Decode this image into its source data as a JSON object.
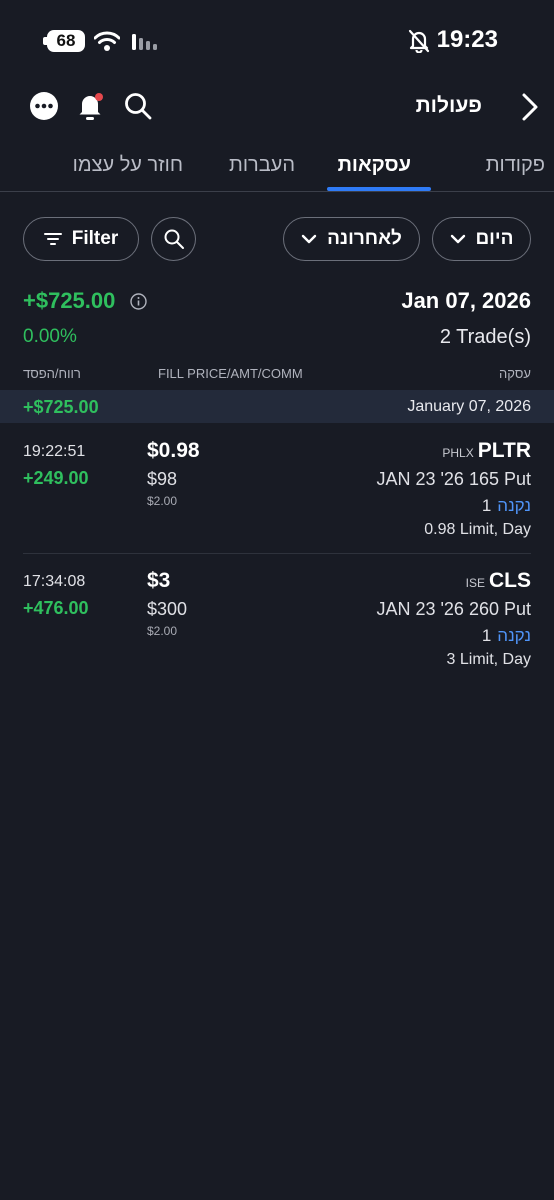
{
  "status_bar": {
    "battery": "68",
    "time": "19:23"
  },
  "header": {
    "title": "פעולות"
  },
  "tabs": [
    {
      "label": "פקודות",
      "active": false
    },
    {
      "label": "עסקאות",
      "active": true
    },
    {
      "label": "העברות",
      "active": false
    },
    {
      "label": "חוזר על עצמו",
      "active": false
    }
  ],
  "filters": {
    "period": "היום",
    "sort": "לאחרונה",
    "filter_label": "Filter"
  },
  "summary": {
    "total_pnl": "+$725.00",
    "percent": "0.00%",
    "date": "Jan 07, 2026",
    "trade_count": "2 Trade(s)"
  },
  "columns": {
    "pnl": "רווח/הפסד",
    "fill": "FILL PRICE/AMT/COMM",
    "trade": "עסקה"
  },
  "day_group": {
    "amount": "+$725.00",
    "date": "January 07, 2026"
  },
  "trades": [
    {
      "time": "19:22:51",
      "pnl": "+249.00",
      "fill_price": "$0.98",
      "amount": "$98",
      "commission": "$2.00",
      "exchange": "PHLX",
      "symbol": "PLTR",
      "contract": "JAN 23 '26 165 Put",
      "side": "נקנה",
      "quantity": "1",
      "order": "0.98 Limit, Day"
    },
    {
      "time": "17:34:08",
      "pnl": "+476.00",
      "fill_price": "$3",
      "amount": "$300",
      "commission": "$2.00",
      "exchange": "ISE",
      "symbol": "CLS",
      "contract": "JAN 23 '26 260 Put",
      "side": "נקנה",
      "quantity": "1",
      "order": "3 Limit, Day"
    }
  ],
  "colors": {
    "accent": "#2f7bf6",
    "positive": "#2fbf5e",
    "background": "#181b24",
    "band": "#232a3a",
    "notification_dot": "#e5484d"
  }
}
